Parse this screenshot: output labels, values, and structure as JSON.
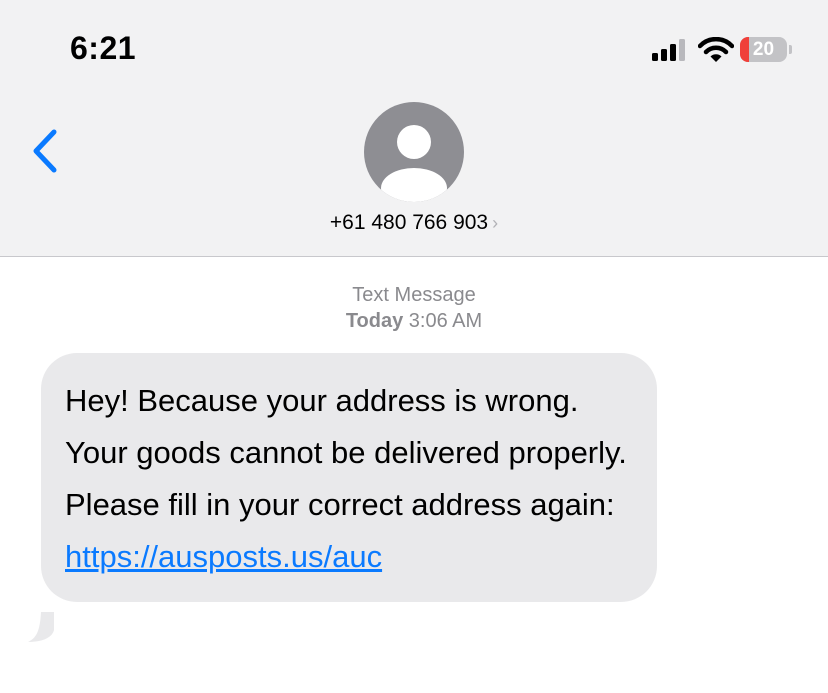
{
  "status_bar": {
    "time": "6:21",
    "battery_level": "20",
    "battery_fraction": 0.2,
    "signal_icon": "cellular-signal-icon",
    "wifi_icon": "wifi-icon"
  },
  "header": {
    "back_icon": "chevron-left-icon",
    "avatar_icon": "person-silhouette-icon",
    "contact_number": "+61 480 766 903",
    "contact_chevron": "›"
  },
  "conversation": {
    "service_label": "Text Message",
    "day_label": "Today",
    "time_label": "3:06 AM",
    "message": {
      "text": "Hey! Because your address is wrong. Your goods cannot be delivered properly. Please fill in your correct address again: ",
      "link": "https://ausposts.us/auc"
    }
  },
  "colors": {
    "header_bg": "#f2f2f3",
    "accent_blue": "#0a7aff",
    "bubble_gray": "#e9e9eb",
    "battery_low": "#f0403a",
    "meta_gray": "#8a8a8e"
  }
}
